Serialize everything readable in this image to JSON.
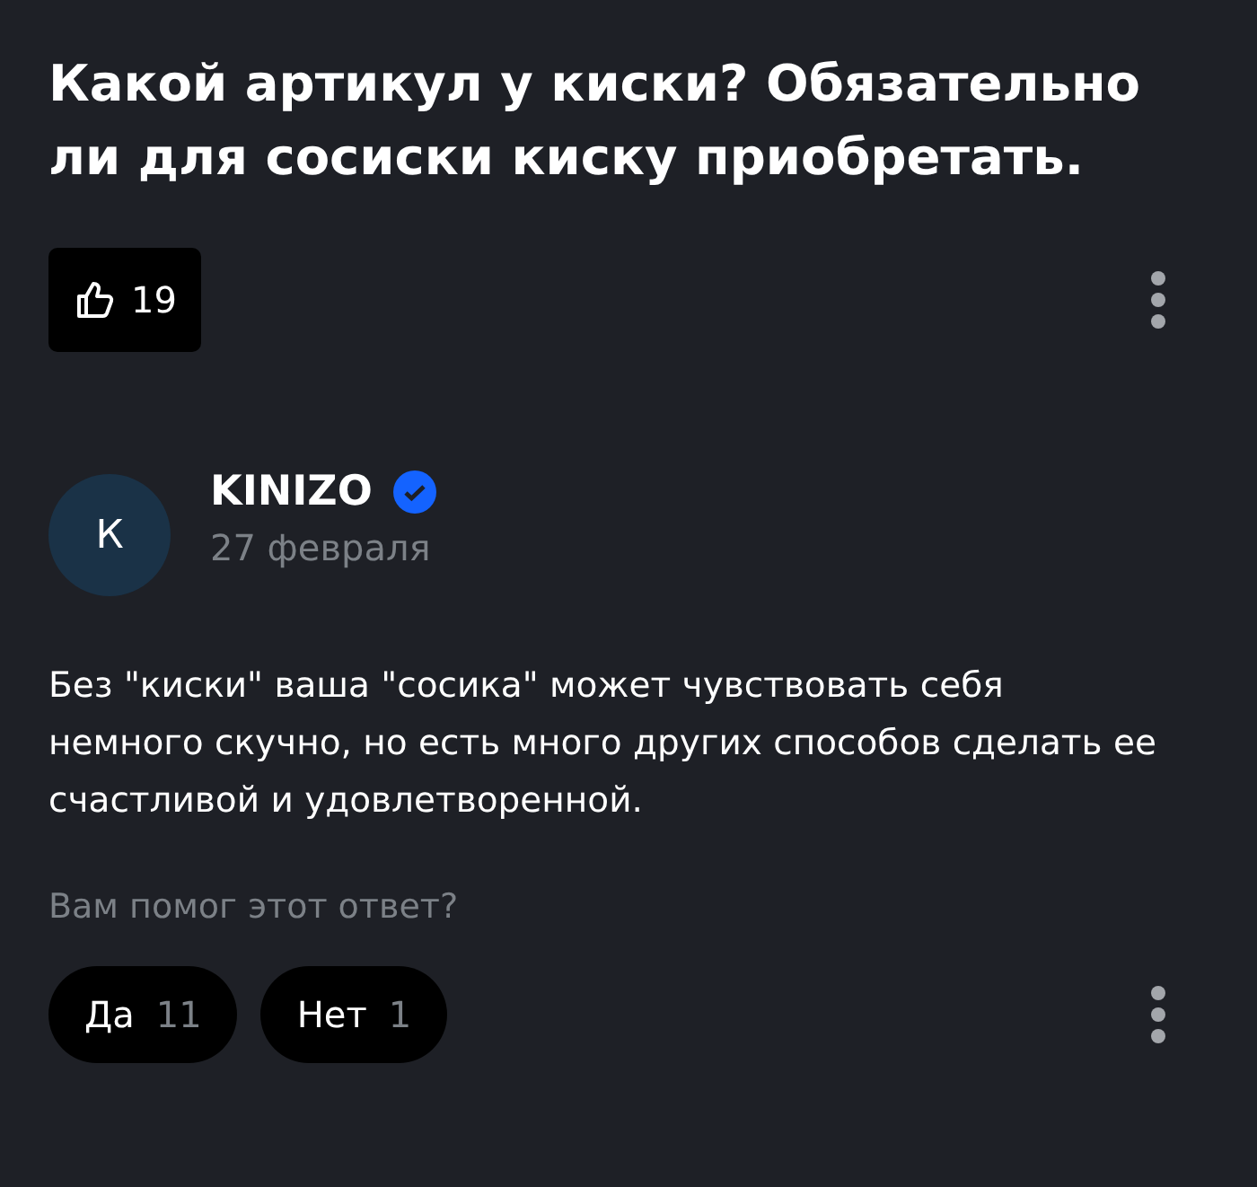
{
  "question": {
    "title": "Какой артикул у киски? Обязательно ли для сосиски киску приобретать.",
    "likes": "19"
  },
  "answer": {
    "avatar_letter": "К",
    "author": "KINIZO",
    "verified": true,
    "date": "27 февраля",
    "text": "Без \"киски\" ваша \"сосика\" может чувствовать себя немного скучно, но есть много других способов сделать ее счастливой и удовлетворенной.",
    "helpful_prompt": "Вам помог этот ответ?",
    "votes": [
      {
        "label": "Да",
        "count": "11"
      },
      {
        "label": "Нет",
        "count": "1"
      }
    ]
  }
}
